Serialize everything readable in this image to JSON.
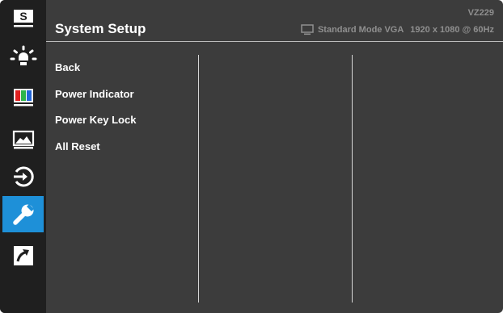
{
  "header": {
    "title": "System Setup",
    "model": "VZ229",
    "mode_label": "Standard Mode VGA",
    "resolution": "1920 x 1080 @ 60Hz"
  },
  "sidebar": {
    "items": [
      {
        "icon": "splendid-icon",
        "glyph": "S"
      },
      {
        "icon": "brightness-icon"
      },
      {
        "icon": "color-icon"
      },
      {
        "icon": "image-icon"
      },
      {
        "icon": "input-select-icon"
      },
      {
        "icon": "wrench-icon",
        "active": true
      },
      {
        "icon": "shortcut-icon"
      }
    ],
    "active_color": "#1e90d8"
  },
  "menu": {
    "items": [
      "Back",
      "Power Indicator",
      "Power Key Lock",
      "All Reset"
    ]
  }
}
